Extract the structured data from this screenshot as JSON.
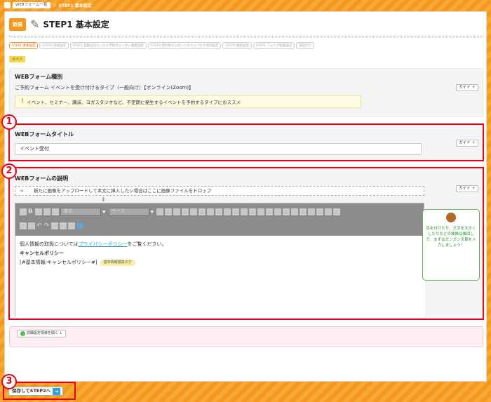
{
  "breadcrumb": {
    "parent": "WEBフォーム一覧",
    "sep": "＞",
    "current": "STEP1 基本設定"
  },
  "header": {
    "new_badge": "新規",
    "title": "STEP1 基本設定"
  },
  "steps": [
    "STEP1 基本設定",
    "STEP2 詳細設定",
    "STEP3 自動返信メール＆予約カレンダー連携設定",
    "STEP4 受付後メッセージ＆キャンセル受付設定",
    "STEP5 権能設定",
    "STEP6 フォルダ移動設定",
    "登録完了"
  ],
  "guide_tag": "ガイド",
  "guide_label": "ガイド ＋",
  "form_type": {
    "label": "WEBフォーム種別",
    "value": "ご予約フォーム イベントを受け付けるタイプ（一般向け）【オンライン(Zoom)】",
    "note": "イベント、セミナー、講演、ヨガスタジオなど、不定期に発生するイベントを予約するタイプにおススメ"
  },
  "form_title": {
    "label": "WEBフォームタイトル",
    "value": "イベント受付"
  },
  "description": {
    "label": "WEBフォームの説明",
    "drop_hint": "新たに画像をアップロードして本文に挿入したい場合はここに画像ファイルをドロップ",
    "toolbar": {
      "format_select": "書式",
      "size_select": "サイズ"
    },
    "body": {
      "line1_prefix": "個人情報の取扱については",
      "line1_link": "プライバシーポリシー",
      "line1_suffix": "をご覧ください。",
      "line2": "キャンセルポリシー",
      "line3": "[#基本情報:キャンセルポリシー#]",
      "line3_chip": "基本情報置換タグ"
    },
    "tip": "色を付けたり、文字を大きくしたりなどの装飾は後回しで、まずはガンガン文章を入力しましょう！"
  },
  "advanced_button": "詳細設定項目を開く ↓",
  "save_button": "保存してSTEP2へ",
  "annotations": [
    "1",
    "2",
    "3"
  ]
}
